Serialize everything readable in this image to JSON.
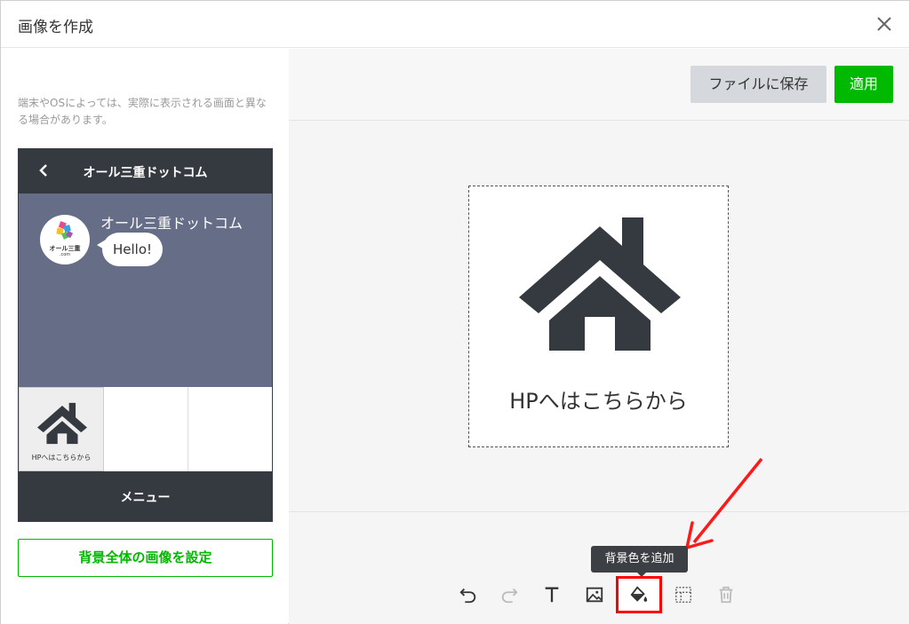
{
  "modal": {
    "title": "画像を作成"
  },
  "left": {
    "notice": "端末やOSによっては、実際に表示される画面と異なる場合があります。",
    "phone": {
      "header_title": "オール三重ドットコム",
      "chat_name": "オール三重ドットコム",
      "bubble_text": "Hello!",
      "avatar_brand": "オール三重",
      "avatar_brand_sub": ".com",
      "rich_menu": [
        {
          "label": "HPへはこちらから"
        },
        {
          "label": ""
        },
        {
          "label": ""
        }
      ],
      "footer_label": "メニュー"
    },
    "bg_button": "背景全体の画像を設定"
  },
  "right": {
    "save_button": "ファイルに保存",
    "apply_button": "適用",
    "canvas_text": "HPへはこちらから",
    "tooltip": "背景色を追加",
    "toolbar": [
      {
        "icon": "undo-icon"
      },
      {
        "icon": "redo-icon"
      },
      {
        "icon": "text-icon"
      },
      {
        "icon": "image-icon"
      },
      {
        "icon": "paint-bucket-icon"
      },
      {
        "icon": "background-grid-icon"
      },
      {
        "icon": "trash-icon"
      }
    ]
  },
  "colors": {
    "green": "#00b900",
    "dark": "#353a41",
    "chat_bg": "#666e87",
    "highlight": "#ff0000"
  }
}
